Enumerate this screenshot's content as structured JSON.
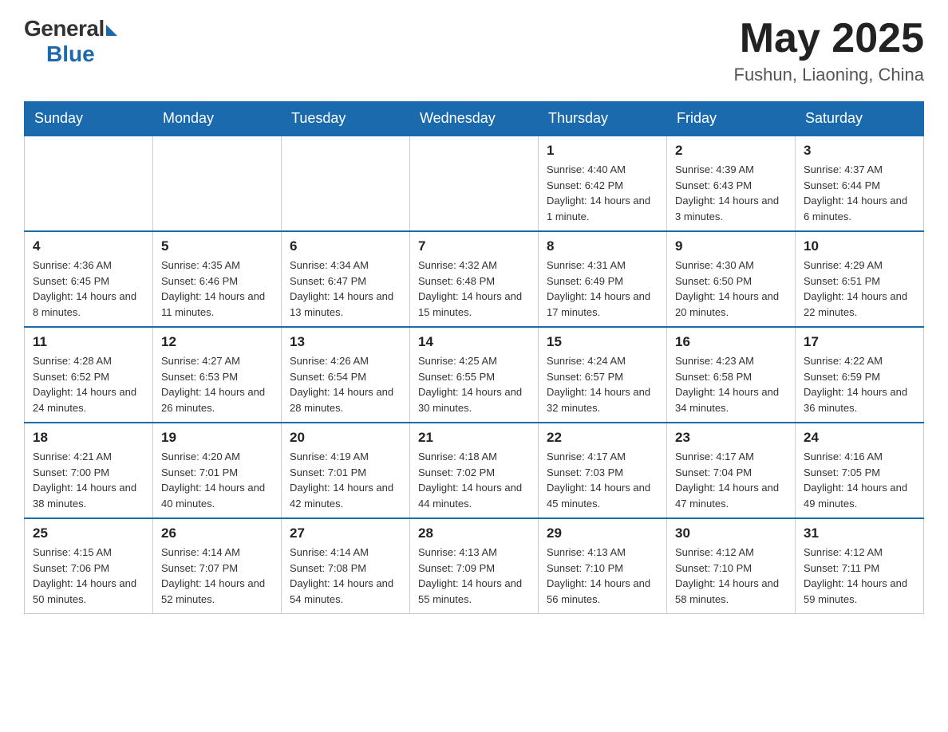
{
  "header": {
    "logo_general": "General",
    "logo_blue": "Blue",
    "month_year": "May 2025",
    "location": "Fushun, Liaoning, China"
  },
  "weekdays": [
    "Sunday",
    "Monday",
    "Tuesday",
    "Wednesday",
    "Thursday",
    "Friday",
    "Saturday"
  ],
  "weeks": [
    [
      {
        "day": "",
        "info": ""
      },
      {
        "day": "",
        "info": ""
      },
      {
        "day": "",
        "info": ""
      },
      {
        "day": "",
        "info": ""
      },
      {
        "day": "1",
        "info": "Sunrise: 4:40 AM\nSunset: 6:42 PM\nDaylight: 14 hours and 1 minute."
      },
      {
        "day": "2",
        "info": "Sunrise: 4:39 AM\nSunset: 6:43 PM\nDaylight: 14 hours and 3 minutes."
      },
      {
        "day": "3",
        "info": "Sunrise: 4:37 AM\nSunset: 6:44 PM\nDaylight: 14 hours and 6 minutes."
      }
    ],
    [
      {
        "day": "4",
        "info": "Sunrise: 4:36 AM\nSunset: 6:45 PM\nDaylight: 14 hours and 8 minutes."
      },
      {
        "day": "5",
        "info": "Sunrise: 4:35 AM\nSunset: 6:46 PM\nDaylight: 14 hours and 11 minutes."
      },
      {
        "day": "6",
        "info": "Sunrise: 4:34 AM\nSunset: 6:47 PM\nDaylight: 14 hours and 13 minutes."
      },
      {
        "day": "7",
        "info": "Sunrise: 4:32 AM\nSunset: 6:48 PM\nDaylight: 14 hours and 15 minutes."
      },
      {
        "day": "8",
        "info": "Sunrise: 4:31 AM\nSunset: 6:49 PM\nDaylight: 14 hours and 17 minutes."
      },
      {
        "day": "9",
        "info": "Sunrise: 4:30 AM\nSunset: 6:50 PM\nDaylight: 14 hours and 20 minutes."
      },
      {
        "day": "10",
        "info": "Sunrise: 4:29 AM\nSunset: 6:51 PM\nDaylight: 14 hours and 22 minutes."
      }
    ],
    [
      {
        "day": "11",
        "info": "Sunrise: 4:28 AM\nSunset: 6:52 PM\nDaylight: 14 hours and 24 minutes."
      },
      {
        "day": "12",
        "info": "Sunrise: 4:27 AM\nSunset: 6:53 PM\nDaylight: 14 hours and 26 minutes."
      },
      {
        "day": "13",
        "info": "Sunrise: 4:26 AM\nSunset: 6:54 PM\nDaylight: 14 hours and 28 minutes."
      },
      {
        "day": "14",
        "info": "Sunrise: 4:25 AM\nSunset: 6:55 PM\nDaylight: 14 hours and 30 minutes."
      },
      {
        "day": "15",
        "info": "Sunrise: 4:24 AM\nSunset: 6:57 PM\nDaylight: 14 hours and 32 minutes."
      },
      {
        "day": "16",
        "info": "Sunrise: 4:23 AM\nSunset: 6:58 PM\nDaylight: 14 hours and 34 minutes."
      },
      {
        "day": "17",
        "info": "Sunrise: 4:22 AM\nSunset: 6:59 PM\nDaylight: 14 hours and 36 minutes."
      }
    ],
    [
      {
        "day": "18",
        "info": "Sunrise: 4:21 AM\nSunset: 7:00 PM\nDaylight: 14 hours and 38 minutes."
      },
      {
        "day": "19",
        "info": "Sunrise: 4:20 AM\nSunset: 7:01 PM\nDaylight: 14 hours and 40 minutes."
      },
      {
        "day": "20",
        "info": "Sunrise: 4:19 AM\nSunset: 7:01 PM\nDaylight: 14 hours and 42 minutes."
      },
      {
        "day": "21",
        "info": "Sunrise: 4:18 AM\nSunset: 7:02 PM\nDaylight: 14 hours and 44 minutes."
      },
      {
        "day": "22",
        "info": "Sunrise: 4:17 AM\nSunset: 7:03 PM\nDaylight: 14 hours and 45 minutes."
      },
      {
        "day": "23",
        "info": "Sunrise: 4:17 AM\nSunset: 7:04 PM\nDaylight: 14 hours and 47 minutes."
      },
      {
        "day": "24",
        "info": "Sunrise: 4:16 AM\nSunset: 7:05 PM\nDaylight: 14 hours and 49 minutes."
      }
    ],
    [
      {
        "day": "25",
        "info": "Sunrise: 4:15 AM\nSunset: 7:06 PM\nDaylight: 14 hours and 50 minutes."
      },
      {
        "day": "26",
        "info": "Sunrise: 4:14 AM\nSunset: 7:07 PM\nDaylight: 14 hours and 52 minutes."
      },
      {
        "day": "27",
        "info": "Sunrise: 4:14 AM\nSunset: 7:08 PM\nDaylight: 14 hours and 54 minutes."
      },
      {
        "day": "28",
        "info": "Sunrise: 4:13 AM\nSunset: 7:09 PM\nDaylight: 14 hours and 55 minutes."
      },
      {
        "day": "29",
        "info": "Sunrise: 4:13 AM\nSunset: 7:10 PM\nDaylight: 14 hours and 56 minutes."
      },
      {
        "day": "30",
        "info": "Sunrise: 4:12 AM\nSunset: 7:10 PM\nDaylight: 14 hours and 58 minutes."
      },
      {
        "day": "31",
        "info": "Sunrise: 4:12 AM\nSunset: 7:11 PM\nDaylight: 14 hours and 59 minutes."
      }
    ]
  ]
}
